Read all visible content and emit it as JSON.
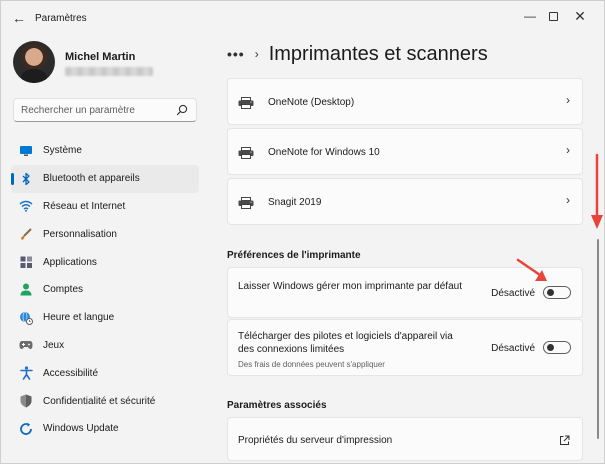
{
  "window": {
    "title": "Paramètres"
  },
  "profile": {
    "name": "Michel Martin"
  },
  "search": {
    "placeholder": "Rechercher un paramètre"
  },
  "sidebar": {
    "items": [
      {
        "label": "Système",
        "icon": "monitor-icon",
        "color": "#0078d4"
      },
      {
        "label": "Bluetooth et appareils",
        "icon": "bluetooth-icon",
        "color": "#0067c0",
        "selected": true
      },
      {
        "label": "Réseau et Internet",
        "icon": "wifi-icon",
        "color": "#1a73c7"
      },
      {
        "label": "Personnalisation",
        "icon": "brush-icon",
        "color": "#d27a2c"
      },
      {
        "label": "Applications",
        "icon": "apps-icon",
        "color": "#5a5a6e"
      },
      {
        "label": "Comptes",
        "icon": "person-icon",
        "color": "#1ea362"
      },
      {
        "label": "Heure et langue",
        "icon": "globe-clock-icon",
        "color": "#2b88d8"
      },
      {
        "label": "Jeux",
        "icon": "gamepad-icon",
        "color": "#6b6b6b"
      },
      {
        "label": "Accessibilité",
        "icon": "accessibility-icon",
        "color": "#1f6fcf"
      },
      {
        "label": "Confidentialité et sécurité",
        "icon": "shield-icon",
        "color": "#6b6b6b"
      },
      {
        "label": "Windows Update",
        "icon": "update-icon",
        "color": "#0f6cbd"
      }
    ]
  },
  "main": {
    "breadcrumb_dots": "•••",
    "page_title": "Imprimantes et scanners",
    "devices": [
      {
        "name": "OneNote (Desktop)"
      },
      {
        "name": "OneNote for Windows 10"
      },
      {
        "name": "Snagit 2019"
      }
    ],
    "printer_prefs": {
      "title": "Préférences de l'imprimante",
      "items": [
        {
          "text": "Laisser Windows gérer mon imprimante par défaut",
          "subtext": "",
          "state": "Désactivé",
          "on": false
        },
        {
          "text": "Télécharger des pilotes et logiciels d'appareil via des connexions limitées",
          "subtext": "Des frais de données peuvent s'appliquer",
          "state": "Désactivé",
          "on": false
        }
      ]
    },
    "related": {
      "title": "Paramètres associés",
      "items": [
        {
          "label": "Propriétés du serveur d'impression"
        }
      ]
    }
  },
  "colors": {
    "accent": "#0067c0",
    "annotation": "#e8443a",
    "window_bg": "#f3f3f3",
    "card_bg": "#fbfbfb"
  }
}
